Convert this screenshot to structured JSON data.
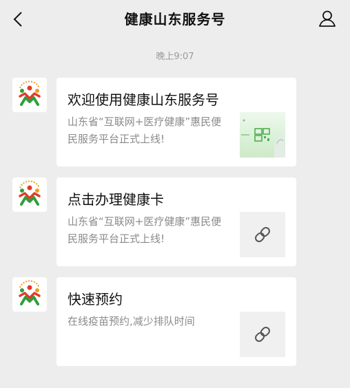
{
  "header": {
    "title": "健康山东服务号",
    "back_icon": "chevron-left-icon",
    "profile_icon": "person-icon"
  },
  "timestamp": "晚上9:07",
  "messages": [
    {
      "title": "欢迎使用健康山东服务号",
      "desc": "山东省“互联网+医疗健康”惠民便民服务平台正式上线!",
      "thumb": "promo-image"
    },
    {
      "title": "点击办理健康卡",
      "desc": "山东省“互联网+医疗健康”惠民便民服务平台正式上线!",
      "thumb": "link-icon"
    },
    {
      "title": "快速预约",
      "desc": "在线疫苗预约,减少排队时间",
      "thumb": "link-icon"
    }
  ],
  "colors": {
    "background": "#ededed",
    "card": "#ffffff",
    "muted_text": "#8a8a8a",
    "logo_green": "#2e9e3a",
    "logo_red": "#e23b2b",
    "logo_orange": "#f29b1d"
  }
}
